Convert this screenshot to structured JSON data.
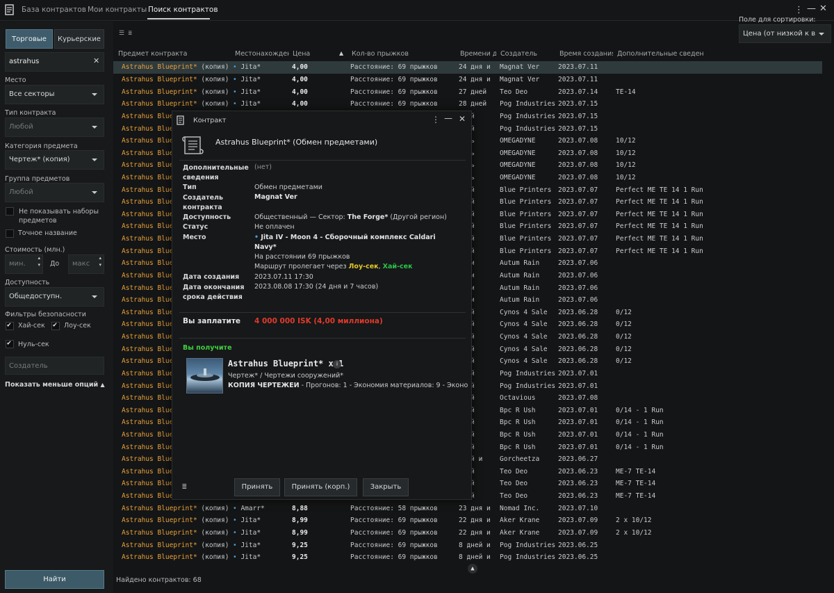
{
  "tabs": [
    "База контрактов",
    "Мои контракты",
    "Поиск контрактов"
  ],
  "sidebar": {
    "type_buttons": [
      "Торговые",
      "Курьерские"
    ],
    "search_value": "astrahus",
    "place_label": "Место",
    "place_value": "Все секторы",
    "contract_type_label": "Тип контракта",
    "contract_type_value": "Любой",
    "item_category_label": "Категория предмета",
    "item_category_value": "Чертеж* (копия)",
    "item_group_label": "Группа предметов",
    "item_group_value": "Любой",
    "hide_bundles_label": "Не показывать наборы предметов",
    "exact_name_label": "Точное название",
    "price_label": "Стоимость (млн.)",
    "price_min_placeholder": "мин.",
    "price_to": "До",
    "price_max_placeholder": "макс",
    "availability_label": "Доступность",
    "availability_value": "Общедоступн.",
    "security_label": "Фильтры безопасности",
    "security_high": "Хай-сек",
    "security_low": "Лоу-сек",
    "security_null": "Нуль-сек",
    "creator_placeholder": "Создатель",
    "show_less": "Показать меньше опций",
    "find_button": "Найти"
  },
  "sort": {
    "label": "Поле для сортировки:",
    "value": "Цена (от низкой к в"
  },
  "table": {
    "headers": [
      "Предмет контракта",
      "Местонахождение",
      "Цена",
      "Кол-во прыжков",
      "Времени до",
      "Создатель",
      "Время создания",
      "Дополнительные сведения"
    ],
    "rows": [
      {
        "name": "Astrahus Blueprint*",
        "copy": "(копия)",
        "loc": "Jita*",
        "price": "4,00",
        "jumps": "Расстояние: 69 прыжков",
        "time": "24 дня и",
        "creator": "Magnat Ver",
        "date": "2023.07.11",
        "info": ""
      },
      {
        "name": "Astrahus Blueprint*",
        "copy": "(копия)",
        "loc": "Jita*",
        "price": "4,00",
        "jumps": "Расстояние: 69 прыжков",
        "time": "24 дня и",
        "creator": "Magnat Ver",
        "date": "2023.07.11",
        "info": ""
      },
      {
        "name": "Astrahus Blueprint*",
        "copy": "(копия)",
        "loc": "Jita*",
        "price": "4,00",
        "jumps": "Расстояние: 69 прыжков",
        "time": "27 дней",
        "creator": "Teo Deo",
        "date": "2023.07.14",
        "info": "TE-14"
      },
      {
        "name": "Astrahus Blueprint*",
        "copy": "(копия)",
        "loc": "Jita*",
        "price": "4,00",
        "jumps": "Расстояние: 69 прыжков",
        "time": "28 дней",
        "creator": "Pog Industries",
        "date": "2023.07.15",
        "info": ""
      },
      {
        "name": "Astrahus Blueprint*",
        "copy": "",
        "loc": "",
        "price": "",
        "jumps": "",
        "time": "дней",
        "creator": "Pog Industries",
        "date": "2023.07.15",
        "info": ""
      },
      {
        "name": "Astrahus Blueprint*",
        "copy": "",
        "loc": "",
        "price": "",
        "jumps": "",
        "time": "дней",
        "creator": "Pog Industries",
        "date": "2023.07.15",
        "info": ""
      },
      {
        "name": "Astrahus Blueprint*",
        "copy": "",
        "loc": "",
        "price": "",
        "jumps": "",
        "time": "день",
        "creator": "OMEGADYNE",
        "date": "2023.07.08",
        "info": "10/12"
      },
      {
        "name": "Astrahus Blueprint*",
        "copy": "",
        "loc": "",
        "price": "",
        "jumps": "",
        "time": "день",
        "creator": "OMEGADYNE",
        "date": "2023.07.08",
        "info": "10/12"
      },
      {
        "name": "Astrahus Blueprint*",
        "copy": "",
        "loc": "",
        "price": "",
        "jumps": "",
        "time": "день",
        "creator": "OMEGADYNE",
        "date": "2023.07.08",
        "info": "10/12"
      },
      {
        "name": "Astrahus Blueprint*",
        "copy": "",
        "loc": "",
        "price": "",
        "jumps": "",
        "time": "день",
        "creator": "OMEGADYNE",
        "date": "2023.07.08",
        "info": "10/12"
      },
      {
        "name": "Astrahus Blueprint*",
        "copy": "",
        "loc": "",
        "price": "",
        "jumps": "",
        "time": "дней",
        "creator": "Blue Printers",
        "date": "2023.07.07",
        "info": "Perfect ME TE 14 1 Run"
      },
      {
        "name": "Astrahus Blueprint*",
        "copy": "",
        "loc": "",
        "price": "",
        "jumps": "",
        "time": "дней",
        "creator": "Blue Printers",
        "date": "2023.07.07",
        "info": "Perfect ME TE 14 1 Run"
      },
      {
        "name": "Astrahus Blueprint*",
        "copy": "",
        "loc": "",
        "price": "",
        "jumps": "",
        "time": "дней",
        "creator": "Blue Printers",
        "date": "2023.07.07",
        "info": "Perfect ME TE 14 1 Run"
      },
      {
        "name": "Astrahus Blueprint*",
        "copy": "",
        "loc": "",
        "price": "",
        "jumps": "",
        "time": "дней",
        "creator": "Blue Printers",
        "date": "2023.07.07",
        "info": "Perfect ME TE 14 1 Run"
      },
      {
        "name": "Astrahus Blueprint*",
        "copy": "",
        "loc": "",
        "price": "",
        "jumps": "",
        "time": "дней",
        "creator": "Blue Printers",
        "date": "2023.07.07",
        "info": "Perfect ME TE 14 1 Run"
      },
      {
        "name": "Astrahus Blueprint*",
        "copy": "",
        "loc": "",
        "price": "",
        "jumps": "",
        "time": "дней",
        "creator": "Blue Printers",
        "date": "2023.07.07",
        "info": "Perfect ME TE 14 1 Run"
      },
      {
        "name": "Astrahus Blueprint*",
        "copy": "",
        "loc": "",
        "price": "",
        "jumps": "",
        "time": "ня и",
        "creator": "Autum Rain",
        "date": "2023.07.06",
        "info": ""
      },
      {
        "name": "Astrahus Blueprint*",
        "copy": "",
        "loc": "",
        "price": "",
        "jumps": "",
        "time": "ня и",
        "creator": "Autum Rain",
        "date": "2023.07.06",
        "info": ""
      },
      {
        "name": "Astrahus Blueprint*",
        "copy": "",
        "loc": "",
        "price": "",
        "jumps": "",
        "time": "ня и",
        "creator": "Autum Rain",
        "date": "2023.07.06",
        "info": ""
      },
      {
        "name": "Astrahus Blueprint*",
        "copy": "",
        "loc": "",
        "price": "",
        "jumps": "",
        "time": "ня и",
        "creator": "Autum Rain",
        "date": "2023.07.06",
        "info": ""
      },
      {
        "name": "Astrahus Blueprint*",
        "copy": "",
        "loc": "",
        "price": "",
        "jumps": "",
        "time": "дней",
        "creator": "Cynos 4 Sale",
        "date": "2023.06.28",
        "info": "0/12"
      },
      {
        "name": "Astrahus Blueprint*",
        "copy": "",
        "loc": "",
        "price": "",
        "jumps": "",
        "time": "дней",
        "creator": "Cynos 4 Sale",
        "date": "2023.06.28",
        "info": "0/12"
      },
      {
        "name": "Astrahus Blueprint*",
        "copy": "",
        "loc": "",
        "price": "",
        "jumps": "",
        "time": "дней",
        "creator": "Cynos 4 Sale",
        "date": "2023.06.28",
        "info": "0/12"
      },
      {
        "name": "Astrahus Blueprint*",
        "copy": "",
        "loc": "",
        "price": "",
        "jumps": "",
        "time": "дней",
        "creator": "Cynos 4 Sale",
        "date": "2023.06.28",
        "info": "0/12"
      },
      {
        "name": "Astrahus Blueprint*",
        "copy": "",
        "loc": "",
        "price": "",
        "jumps": "",
        "time": "дней",
        "creator": "Cynos 4 Sale",
        "date": "2023.06.28",
        "info": "0/12"
      },
      {
        "name": "Astrahus Blueprint*",
        "copy": "",
        "loc": "",
        "price": "",
        "jumps": "",
        "time": "дней",
        "creator": "Pog Industries",
        "date": "2023.07.01",
        "info": ""
      },
      {
        "name": "Astrahus Blueprint*",
        "copy": "",
        "loc": "",
        "price": "",
        "jumps": "",
        "time": "дней",
        "creator": "Pog Industries",
        "date": "2023.07.01",
        "info": ""
      },
      {
        "name": "Astrahus Blueprint*",
        "copy": "",
        "loc": "",
        "price": "",
        "jumps": "",
        "time": "дней",
        "creator": "Octavious",
        "date": "2023.07.08",
        "info": ""
      },
      {
        "name": "Astrahus Blueprint*",
        "copy": "",
        "loc": "",
        "price": "",
        "jumps": "",
        "time": "дней",
        "creator": "Bpc R Ush",
        "date": "2023.07.01",
        "info": "0/14 - 1 Run"
      },
      {
        "name": "Astrahus Blueprint*",
        "copy": "",
        "loc": "",
        "price": "",
        "jumps": "",
        "time": "дней",
        "creator": "Bpc R Ush",
        "date": "2023.07.01",
        "info": "0/14 - 1 Run"
      },
      {
        "name": "Astrahus Blueprint*",
        "copy": "",
        "loc": "",
        "price": "",
        "jumps": "",
        "time": "дней",
        "creator": "Bpc R Ush",
        "date": "2023.07.01",
        "info": "0/14 - 1 Run"
      },
      {
        "name": "Astrahus Blueprint*",
        "copy": "",
        "loc": "",
        "price": "",
        "jumps": "",
        "time": "дней",
        "creator": "Bpc R Ush",
        "date": "2023.07.01",
        "info": "0/14 - 1 Run"
      },
      {
        "name": "Astrahus Blueprint*",
        "copy": "",
        "loc": "",
        "price": "",
        "jumps": "",
        "time": "дней и",
        "creator": "Gorcheetza",
        "date": "2023.06.27",
        "info": ""
      },
      {
        "name": "Astrahus Blueprint*",
        "copy": "",
        "loc": "",
        "price": "",
        "jumps": "",
        "time": "дней",
        "creator": "Teo Deo",
        "date": "2023.06.23",
        "info": "ME-7 TE-14"
      },
      {
        "name": "Astrahus Blueprint*",
        "copy": "",
        "loc": "",
        "price": "",
        "jumps": "",
        "time": "дней",
        "creator": "Teo Deo",
        "date": "2023.06.23",
        "info": "ME-7 TE-14"
      },
      {
        "name": "Astrahus Blueprint*",
        "copy": "",
        "loc": "",
        "price": "",
        "jumps": "",
        "time": "дней",
        "creator": "Teo Deo",
        "date": "2023.06.23",
        "info": "ME-7 TE-14"
      },
      {
        "name": "Astrahus Blueprint*",
        "copy": "(копия)",
        "loc": "Amarr*",
        "price": "8,88",
        "jumps": "Расстояние: 58 прыжков",
        "time": "23 дня и",
        "creator": "Nomad Inc.",
        "date": "2023.07.10",
        "info": ""
      },
      {
        "name": "Astrahus Blueprint*",
        "copy": "(копия)",
        "loc": "Jita*",
        "price": "8,99",
        "jumps": "Расстояние: 69 прыжков",
        "time": "22 дня и",
        "creator": "Aker Krane",
        "date": "2023.07.09",
        "info": "2 x 10/12"
      },
      {
        "name": "Astrahus Blueprint*",
        "copy": "(копия)",
        "loc": "Jita*",
        "price": "8,99",
        "jumps": "Расстояние: 69 прыжков",
        "time": "22 дня и",
        "creator": "Aker Krane",
        "date": "2023.07.09",
        "info": "2 x 10/12"
      },
      {
        "name": "Astrahus Blueprint*",
        "copy": "(копия)",
        "loc": "Jita*",
        "price": "9,25",
        "jumps": "Расстояние: 69 прыжков",
        "time": "8 дней и",
        "creator": "Pog Industries",
        "date": "2023.06.25",
        "info": ""
      },
      {
        "name": "Astrahus Blueprint*",
        "copy": "(копия)",
        "loc": "Jita*",
        "price": "9,25",
        "jumps": "Расстояние: 69 прыжков",
        "time": "8 дней и",
        "creator": "Pog Industries",
        "date": "2023.06.25",
        "info": ""
      }
    ]
  },
  "footer": {
    "found": "Найдено контрактов: 68"
  },
  "dialog": {
    "window_title": "Контракт",
    "title": "Astrahus Blueprint* (Обмен предметами)",
    "fields": {
      "info_label": "Дополнительные сведения",
      "info_value": "(нет)",
      "type_label": "Тип",
      "type_value": "Обмен предметами",
      "creator_label": "Создатель контракта",
      "creator_value": "Magnat Ver",
      "avail_label": "Доступность",
      "avail_prefix": "Общественный — Сектор: ",
      "avail_region": "The Forge*",
      "avail_suffix": " (Другой регион)",
      "status_label": "Статус",
      "status_value": "Не оплачен",
      "place_label": "Место",
      "place_line1": "Jita IV - Moon 4 - Сборочный комплекс Caldari",
      "place_line2": "Navy*",
      "place_distance": "На расстоянии 69 прыжков",
      "route_prefix": "Маршрут пролегает через ",
      "route_low": "Лоу-сек",
      "route_sep": ", ",
      "route_high": "Хай-сек",
      "created_label": "Дата создания",
      "created_value": "2023.07.11 17:30",
      "expires_label": "Дата окончания срока действия",
      "expires_value": "2023.08.08 17:30 (24 дня и 7 часов)"
    },
    "pay_label": "Вы заплатите",
    "pay_value": "4 000 000 ISK (4,00 миллиона)",
    "receive_label": "Вы получите",
    "item_name": "Astrahus Blueprint* x 1",
    "item_category": "Чертеж* / Чертежи сооружений*",
    "item_details_prefix": "КОПИЯ ЧЕРТЕЖЕЙ",
    "item_details": " - Прогонов: 1 - Экономия материалов: 9 - Эконо",
    "buttons": [
      "Принять",
      "Принять (корп.)",
      "Закрыть"
    ]
  },
  "colors": {
    "accent_orange": "#e8a23a",
    "price_red": "#e03a2c",
    "security_high": "#2ec24a",
    "security_low": "#e6c82b",
    "receive_green": "#3fcf3f"
  }
}
